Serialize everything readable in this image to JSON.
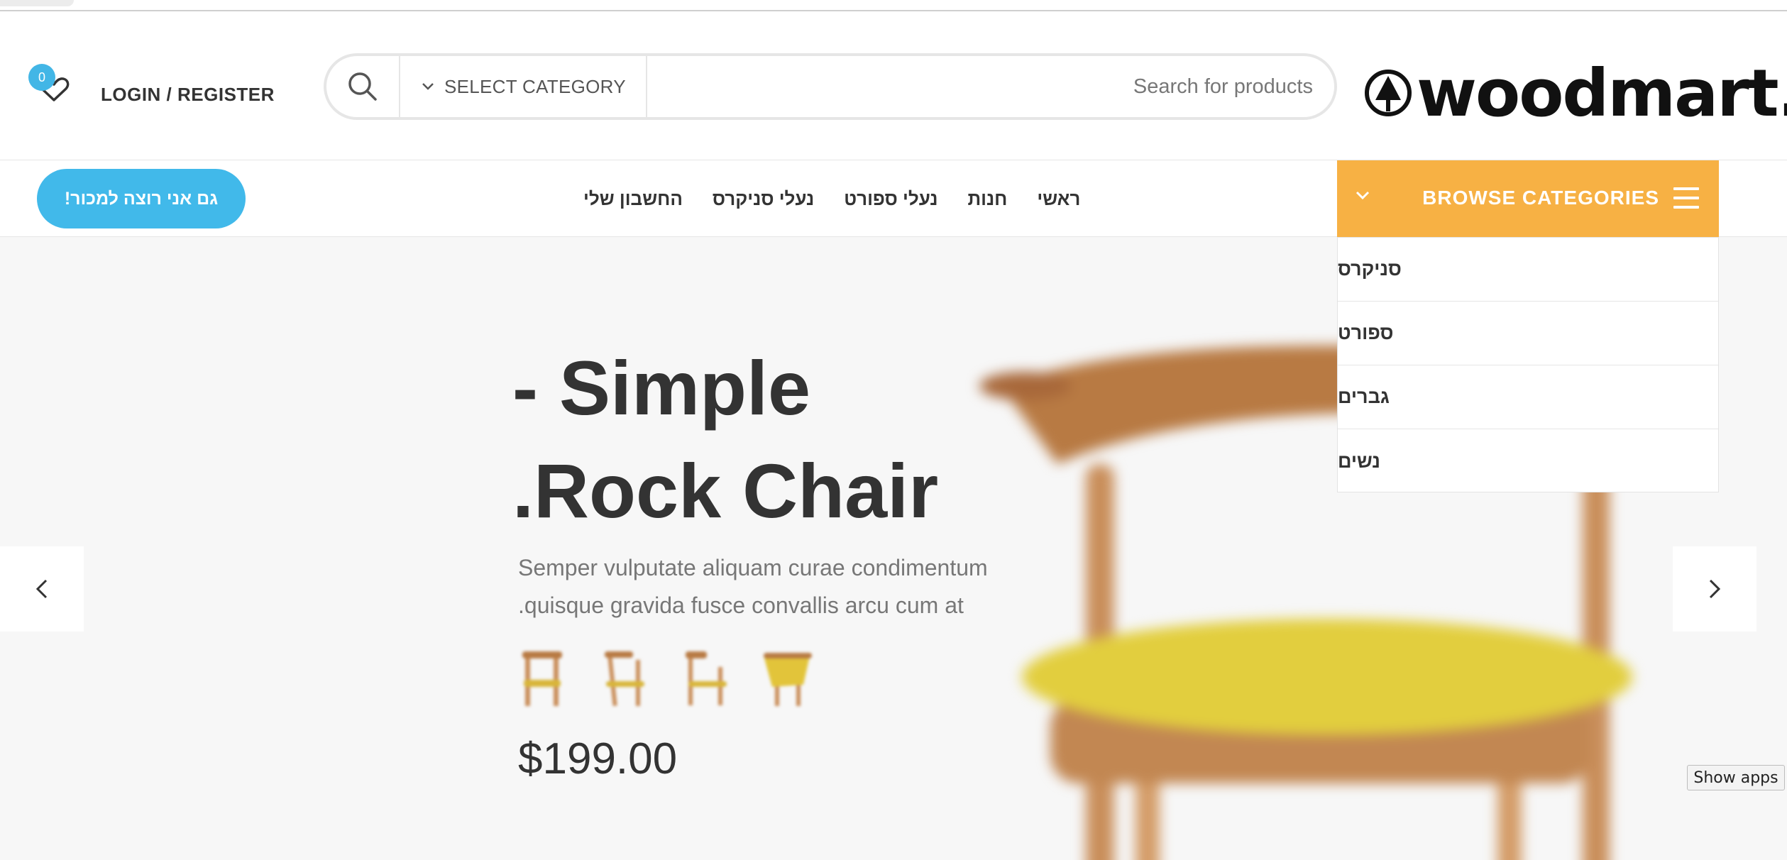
{
  "header": {
    "wishlist_count": "0",
    "login_label": "LOGIN / REGISTER",
    "search": {
      "category_label": "SELECT CATEGORY",
      "placeholder": "Search for products"
    },
    "logo_text": "woodmart."
  },
  "nav": {
    "sell_button": "גם אני רוצה למכור!",
    "menu": [
      "ראשי",
      "חנות",
      "נעלי ספורט",
      "נעלי סניקרס",
      "החשבון שלי"
    ],
    "browse_label": "BROWSE CATEGORIES"
  },
  "dropdown": {
    "items": [
      "סניקרס",
      "ספורט",
      "גברים",
      "נשים"
    ]
  },
  "hero": {
    "title_line1": "- Simple",
    "title_line2": ".Rock Chair",
    "desc_line1": "Semper vulputate aliquam curae condimentum",
    "desc_line2": ".quisque gravida fusce convallis arcu cum at",
    "price": "$199.00"
  },
  "system": {
    "show_apps": "Show apps"
  },
  "colors": {
    "accent_orange": "#f7b144",
    "accent_blue": "#41b9ea",
    "text_dark": "#333333"
  }
}
